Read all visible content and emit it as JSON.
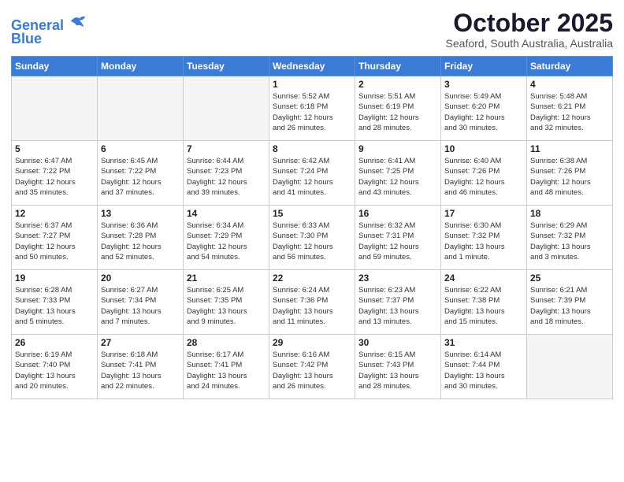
{
  "header": {
    "logo_line1": "General",
    "logo_line2": "Blue",
    "title": "October 2025",
    "location": "Seaford, South Australia, Australia"
  },
  "weekdays": [
    "Sunday",
    "Monday",
    "Tuesday",
    "Wednesday",
    "Thursday",
    "Friday",
    "Saturday"
  ],
  "weeks": [
    [
      {
        "day": "",
        "info": ""
      },
      {
        "day": "",
        "info": ""
      },
      {
        "day": "",
        "info": ""
      },
      {
        "day": "1",
        "info": "Sunrise: 5:52 AM\nSunset: 6:18 PM\nDaylight: 12 hours\nand 26 minutes."
      },
      {
        "day": "2",
        "info": "Sunrise: 5:51 AM\nSunset: 6:19 PM\nDaylight: 12 hours\nand 28 minutes."
      },
      {
        "day": "3",
        "info": "Sunrise: 5:49 AM\nSunset: 6:20 PM\nDaylight: 12 hours\nand 30 minutes."
      },
      {
        "day": "4",
        "info": "Sunrise: 5:48 AM\nSunset: 6:21 PM\nDaylight: 12 hours\nand 32 minutes."
      }
    ],
    [
      {
        "day": "5",
        "info": "Sunrise: 6:47 AM\nSunset: 7:22 PM\nDaylight: 12 hours\nand 35 minutes."
      },
      {
        "day": "6",
        "info": "Sunrise: 6:45 AM\nSunset: 7:22 PM\nDaylight: 12 hours\nand 37 minutes."
      },
      {
        "day": "7",
        "info": "Sunrise: 6:44 AM\nSunset: 7:23 PM\nDaylight: 12 hours\nand 39 minutes."
      },
      {
        "day": "8",
        "info": "Sunrise: 6:42 AM\nSunset: 7:24 PM\nDaylight: 12 hours\nand 41 minutes."
      },
      {
        "day": "9",
        "info": "Sunrise: 6:41 AM\nSunset: 7:25 PM\nDaylight: 12 hours\nand 43 minutes."
      },
      {
        "day": "10",
        "info": "Sunrise: 6:40 AM\nSunset: 7:26 PM\nDaylight: 12 hours\nand 46 minutes."
      },
      {
        "day": "11",
        "info": "Sunrise: 6:38 AM\nSunset: 7:26 PM\nDaylight: 12 hours\nand 48 minutes."
      }
    ],
    [
      {
        "day": "12",
        "info": "Sunrise: 6:37 AM\nSunset: 7:27 PM\nDaylight: 12 hours\nand 50 minutes."
      },
      {
        "day": "13",
        "info": "Sunrise: 6:36 AM\nSunset: 7:28 PM\nDaylight: 12 hours\nand 52 minutes."
      },
      {
        "day": "14",
        "info": "Sunrise: 6:34 AM\nSunset: 7:29 PM\nDaylight: 12 hours\nand 54 minutes."
      },
      {
        "day": "15",
        "info": "Sunrise: 6:33 AM\nSunset: 7:30 PM\nDaylight: 12 hours\nand 56 minutes."
      },
      {
        "day": "16",
        "info": "Sunrise: 6:32 AM\nSunset: 7:31 PM\nDaylight: 12 hours\nand 59 minutes."
      },
      {
        "day": "17",
        "info": "Sunrise: 6:30 AM\nSunset: 7:32 PM\nDaylight: 13 hours\nand 1 minute."
      },
      {
        "day": "18",
        "info": "Sunrise: 6:29 AM\nSunset: 7:32 PM\nDaylight: 13 hours\nand 3 minutes."
      }
    ],
    [
      {
        "day": "19",
        "info": "Sunrise: 6:28 AM\nSunset: 7:33 PM\nDaylight: 13 hours\nand 5 minutes."
      },
      {
        "day": "20",
        "info": "Sunrise: 6:27 AM\nSunset: 7:34 PM\nDaylight: 13 hours\nand 7 minutes."
      },
      {
        "day": "21",
        "info": "Sunrise: 6:25 AM\nSunset: 7:35 PM\nDaylight: 13 hours\nand 9 minutes."
      },
      {
        "day": "22",
        "info": "Sunrise: 6:24 AM\nSunset: 7:36 PM\nDaylight: 13 hours\nand 11 minutes."
      },
      {
        "day": "23",
        "info": "Sunrise: 6:23 AM\nSunset: 7:37 PM\nDaylight: 13 hours\nand 13 minutes."
      },
      {
        "day": "24",
        "info": "Sunrise: 6:22 AM\nSunset: 7:38 PM\nDaylight: 13 hours\nand 15 minutes."
      },
      {
        "day": "25",
        "info": "Sunrise: 6:21 AM\nSunset: 7:39 PM\nDaylight: 13 hours\nand 18 minutes."
      }
    ],
    [
      {
        "day": "26",
        "info": "Sunrise: 6:19 AM\nSunset: 7:40 PM\nDaylight: 13 hours\nand 20 minutes."
      },
      {
        "day": "27",
        "info": "Sunrise: 6:18 AM\nSunset: 7:41 PM\nDaylight: 13 hours\nand 22 minutes."
      },
      {
        "day": "28",
        "info": "Sunrise: 6:17 AM\nSunset: 7:41 PM\nDaylight: 13 hours\nand 24 minutes."
      },
      {
        "day": "29",
        "info": "Sunrise: 6:16 AM\nSunset: 7:42 PM\nDaylight: 13 hours\nand 26 minutes."
      },
      {
        "day": "30",
        "info": "Sunrise: 6:15 AM\nSunset: 7:43 PM\nDaylight: 13 hours\nand 28 minutes."
      },
      {
        "day": "31",
        "info": "Sunrise: 6:14 AM\nSunset: 7:44 PM\nDaylight: 13 hours\nand 30 minutes."
      },
      {
        "day": "",
        "info": ""
      }
    ]
  ]
}
